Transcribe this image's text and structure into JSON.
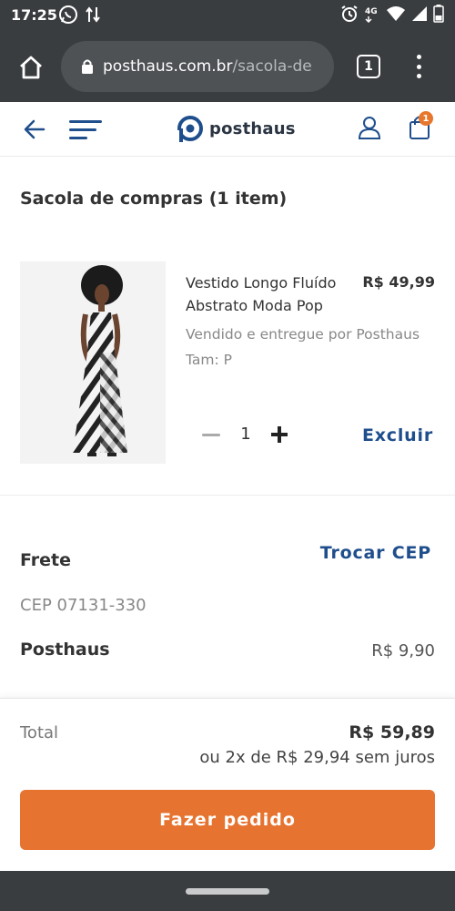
{
  "status_bar": {
    "time": "17:25",
    "left_icons": [
      "whatsapp-icon",
      "data-sync-icon"
    ],
    "right_icons": [
      "alarm-icon",
      "4g-icon",
      "wifi-icon",
      "signal-icon",
      "battery-icon"
    ]
  },
  "browser": {
    "url_host": "posthaus.com.br",
    "url_path": "/sacola-de",
    "tab_count": "1"
  },
  "header": {
    "brand": "posthaus",
    "bag_count": "1"
  },
  "page": {
    "title": "Sacola de compras (1 item)"
  },
  "cart_item": {
    "name": "Vestido Longo Fluído Abstrato Moda Pop",
    "price": "R$ 49,99",
    "seller": "Vendido e entregue por Posthaus",
    "size": "Tam: P",
    "quantity": "1",
    "remove_label": "Excluir"
  },
  "shipping": {
    "title": "Frete",
    "change_label": "Trocar CEP",
    "cep": "CEP 07131-330",
    "carrier": "Posthaus",
    "carrier_price": "R$ 9,90"
  },
  "summary": {
    "total_label": "Total",
    "total_value": "R$ 59,89",
    "installments": "ou 2x de R$ 29,94 sem juros",
    "order_button": "Fazer pedido"
  },
  "colors": {
    "accent_blue": "#1f4e8c",
    "cta_orange": "#e6732f",
    "chrome_dark": "#3a3d40"
  }
}
